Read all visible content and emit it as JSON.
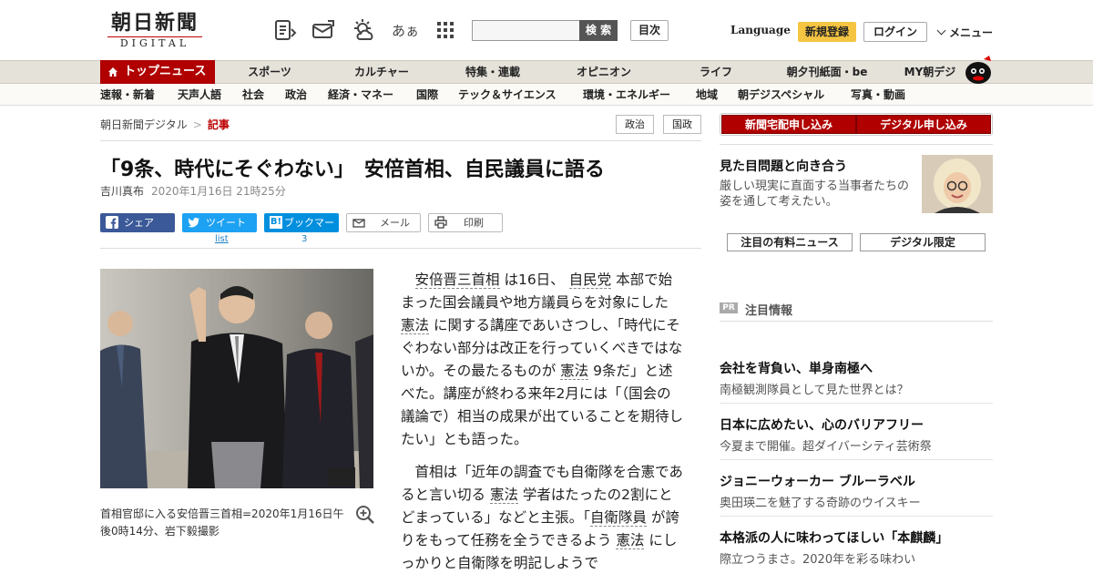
{
  "header": {
    "logo_main": "朝日新聞",
    "logo_sub": "DIGITAL",
    "icons": [
      "news-list-icon",
      "mail-icon",
      "weather-icon",
      "font-size-icon",
      "apps-grid-icon"
    ],
    "font_icon_label": "あぁ",
    "search_placeholder": "",
    "search_button": "検 索",
    "index_button": "目次",
    "language": "Language",
    "register": "新規登録",
    "login": "ログイン",
    "menu": "メニュー"
  },
  "nav": {
    "top": "トップニュース",
    "items": [
      "スポーツ",
      "カルチャー",
      "特集・連載",
      "オピニオン",
      "ライフ",
      "朝夕刊紙面・be",
      "MY朝デジ"
    ],
    "sub": [
      "速報・新着",
      "天声人語",
      "社会",
      "政治",
      "経済・マネー",
      "国際",
      "テック＆サイエンス",
      "環境・エネルギー",
      "地域",
      "朝デジスペシャル",
      "写真・動画"
    ]
  },
  "article": {
    "breadcrumb": [
      "朝日新聞デジタル",
      "記事"
    ],
    "breadcrumb_sep": ">",
    "tags": [
      "政治",
      "国政"
    ],
    "title": "「9条、時代にそぐわない」　安倍首相、自民議員に語る",
    "author": "吉川真布",
    "date": "2020年1月16日 21時25分",
    "share": {
      "facebook": "シェア",
      "twitter": "ツイート",
      "hatena": "ブックマーク",
      "mail": "メール",
      "print": "印刷",
      "twitter_count": "list",
      "hatena_count": "3"
    },
    "caption": "首相官邸に入る安倍晋三首相=2020年1月16日午後0時14分、岩下毅撮影",
    "p1": {
      "s1": "安倍晋三首相",
      "s2": "は16日、",
      "s3": "自民党",
      "s4": "本部で始まった国会議員や地方議員らを対象にした",
      "s5": "憲法",
      "s6": "に関する講座であいさつし、「時代にそぐわない部分は改正を行っていくべきではないか。その最たるものが",
      "s7": "憲法",
      "s8": "9条だ」と述べた。講座が終わる来年2月には「（国会の議論で）相当の成果が出ていることを期待したい」とも語った。"
    },
    "p2": {
      "s1": "首相は「近年の調査でも自衛隊を合憲であると言い切る",
      "s2": "憲法",
      "s3": "学者はたったの2割にとどまっている」などと主張。「",
      "s4": "自衛隊員",
      "s5": "が誇りをもって任務を全うできるよう",
      "s6": "憲法",
      "s7": "にしっかりと自衛隊を明記しようで"
    }
  },
  "sidebar": {
    "promo_home": "新聞宅配申し込み",
    "promo_digital": "デジタル申し込み",
    "feature_title": "見た目問題と向き合う",
    "feature_desc": "厳しい現実に直面する当事者たちの姿を通して考えたい。",
    "btn_paid": "注目の有料ニュース",
    "btn_limited": "デジタル限定",
    "pr_badge": "PR",
    "pr_title": "注目情報",
    "pr_items": [
      {
        "title": "会社を背負い、単身南極へ",
        "desc": "南極観測隊員として見た世界とは？"
      },
      {
        "title": "日本に広めたい、心のバリアフリー",
        "desc": "今夏まで開催。超ダイバーシティ芸術祭"
      },
      {
        "title": "ジョニーウォーカー ブルーラベル",
        "desc": "奥田瑛二を魅了する奇跡のウイスキー"
      },
      {
        "title": "本格派の人に味わってほしい「本麒麟」",
        "desc": "際立つうまさ。2020年を彩る味わい"
      }
    ]
  },
  "colors": {
    "brand_red": "#b00000",
    "facebook": "#3b5998",
    "twitter": "#1da1f2",
    "hatena": "#008fde",
    "register_yellow": "#f5c542"
  }
}
